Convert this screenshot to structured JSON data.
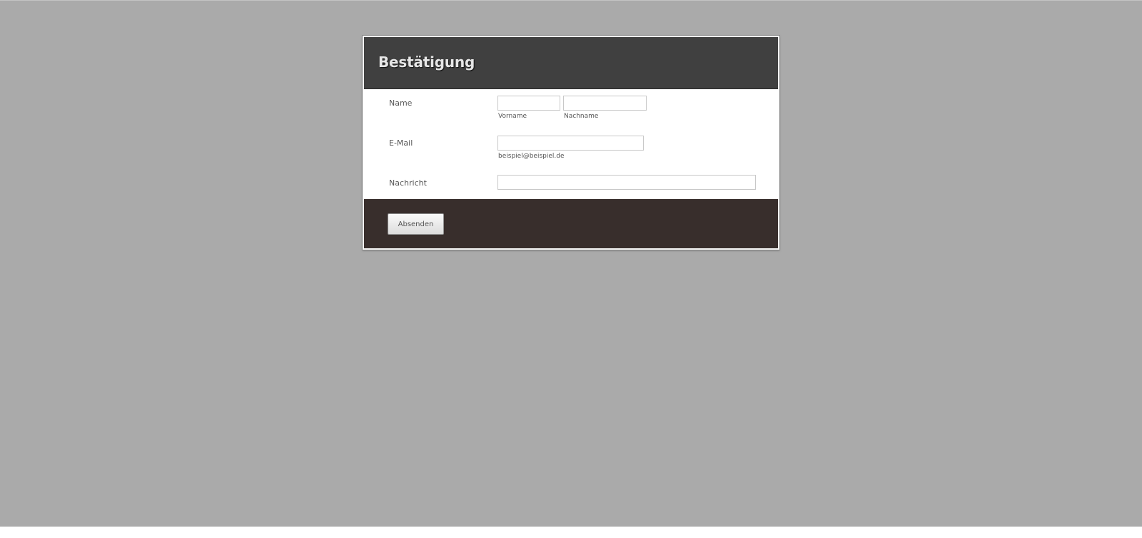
{
  "form": {
    "title": "Bestätigung",
    "fields": {
      "name": {
        "label": "Name",
        "first": {
          "value": "",
          "sublabel": "Vorname"
        },
        "last": {
          "value": "",
          "sublabel": "Nachname"
        }
      },
      "email": {
        "label": "E-Mail",
        "value": "",
        "sublabel": "beispiel@beispiel.de"
      },
      "message": {
        "label": "Nachricht",
        "value": ""
      }
    },
    "submit_label": "Absenden"
  },
  "colors": {
    "page_background": "#aaaaaa",
    "header_background": "#404040",
    "footer_background": "#382e2c",
    "title_text": "#e6e6e6"
  }
}
